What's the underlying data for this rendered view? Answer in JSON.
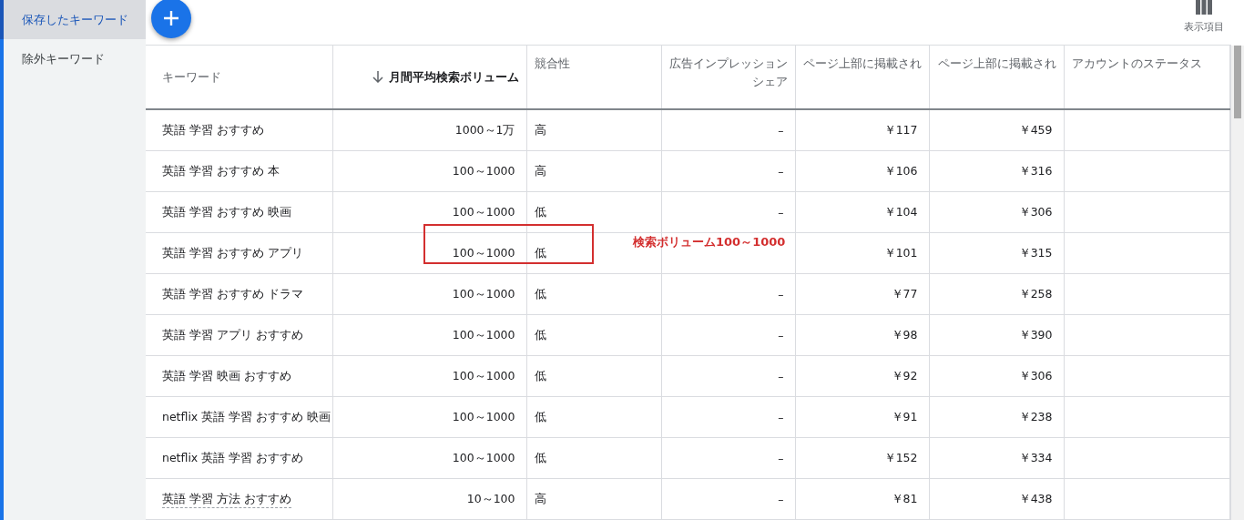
{
  "sidebar": {
    "items": [
      {
        "label": "保存したキーワード",
        "selected": true
      },
      {
        "label": "除外キーワード",
        "selected": false
      }
    ]
  },
  "toolbar": {
    "columns_button": "表示項目"
  },
  "table": {
    "columns": [
      {
        "label": "キーワード",
        "sorted": false
      },
      {
        "label": "月間平均検索ボリューム",
        "sorted": true
      },
      {
        "label": "競合性",
        "sorted": false
      },
      {
        "label": "広告インプレッションシェア",
        "sorted": false
      },
      {
        "label": "ページ上部に掲載され",
        "sorted": false
      },
      {
        "label": "ページ上部に掲載され",
        "sorted": false
      },
      {
        "label": "アカウントのステータス",
        "sorted": false
      }
    ],
    "rows": [
      {
        "cells": [
          "英語 学習 おすすめ",
          "1000～1万",
          "高",
          "–",
          "￥117",
          "￥459",
          ""
        ],
        "underlined": false
      },
      {
        "cells": [
          "英語 学習 おすすめ 本",
          "100～1000",
          "高",
          "–",
          "￥106",
          "￥316",
          ""
        ],
        "underlined": false
      },
      {
        "cells": [
          "英語 学習 おすすめ 映画",
          "100～1000",
          "低",
          "–",
          "￥104",
          "￥306",
          ""
        ],
        "underlined": false
      },
      {
        "cells": [
          "英語 学習 おすすめ アプリ",
          "100～1000",
          "低",
          "",
          "￥101",
          "￥315",
          ""
        ],
        "underlined": false,
        "annotation": "検索ボリューム100～1000"
      },
      {
        "cells": [
          "英語 学習 おすすめ ドラマ",
          "100～1000",
          "低",
          "–",
          "￥77",
          "￥258",
          ""
        ],
        "underlined": false
      },
      {
        "cells": [
          "英語 学習 アプリ おすすめ",
          "100～1000",
          "低",
          "–",
          "￥98",
          "￥390",
          ""
        ],
        "underlined": false
      },
      {
        "cells": [
          "英語 学習 映画 おすすめ",
          "100～1000",
          "低",
          "–",
          "￥92",
          "￥306",
          ""
        ],
        "underlined": false
      },
      {
        "cells": [
          "netflix 英語 学習 おすすめ 映画",
          "100～1000",
          "低",
          "–",
          "￥91",
          "￥238",
          ""
        ],
        "underlined": false
      },
      {
        "cells": [
          "netflix 英語 学習 おすすめ",
          "100～1000",
          "低",
          "–",
          "￥152",
          "￥334",
          ""
        ],
        "underlined": false
      },
      {
        "cells": [
          "英語 学習 方法 おすすめ",
          "10～100",
          "高",
          "–",
          "￥81",
          "￥438",
          ""
        ],
        "underlined": true
      }
    ]
  }
}
